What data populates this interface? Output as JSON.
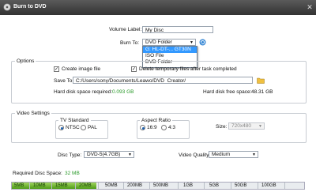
{
  "window": {
    "title": "Burn to DVD",
    "close_glyph": "✕"
  },
  "volume_label": {
    "label": "Volume Label:",
    "value": "My Disc"
  },
  "burn_to": {
    "label": "Burn To:",
    "selected": "DVD Folder",
    "options": [
      "G: HL-DT-... GT30N",
      "ISO File",
      "DVD Folder"
    ],
    "highlighted_index": 0,
    "refresh_icon": "refresh-icon"
  },
  "options": {
    "legend": "Options",
    "create_image": {
      "label": "Create image file",
      "checked": true
    },
    "delete_temp": {
      "label": "Delete temporary files after task completed",
      "checked": true
    },
    "save_to": {
      "label": "Save To:",
      "value": "C:/Users/sony/Documents/Leawo/DVD_Creator/",
      "folder_icon": "folder-icon"
    },
    "required": {
      "label": "Hard disk space required:",
      "value": "0.093 GB"
    },
    "free": {
      "label": "Hard disk free space:",
      "value": "48.31 GB"
    }
  },
  "video_settings": {
    "legend": "Video Settings",
    "tv_standard": {
      "legend": "TV Standard",
      "options": [
        "NTSC",
        "PAL"
      ],
      "selected": "NTSC"
    },
    "aspect_ratio": {
      "legend": "Aspect Ratio",
      "options": [
        "16:9",
        "4:3"
      ],
      "selected": "16:9"
    },
    "size": {
      "label": "Size:",
      "value": "720x480"
    }
  },
  "disc_type": {
    "label": "Disc Type:",
    "value": "DVD-5(4.7GB)"
  },
  "video_quality": {
    "label": "Video Quality:",
    "value": "Medium"
  },
  "required_disc_space": {
    "label": "Required Disc Space:",
    "value": "32 MB"
  },
  "space_bar": {
    "used_mb": 32,
    "ticks": [
      "5MB",
      "10MB",
      "15MB",
      "20MB",
      "50MB",
      "200MB",
      "500MB",
      "1GB",
      "5GB",
      "50GB",
      "100GB"
    ]
  },
  "colors": {
    "accent_green": "#2a9a2a",
    "selection_blue": "#3399ff",
    "bar_fill": "#6fb52e"
  }
}
